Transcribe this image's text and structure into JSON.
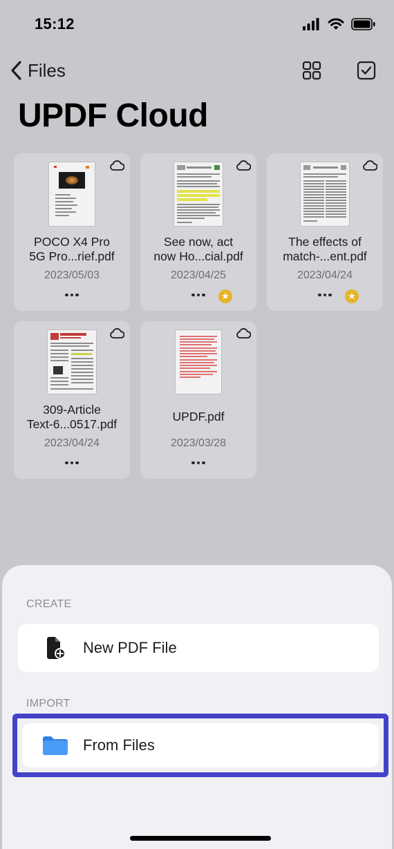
{
  "status": {
    "time": "15:12",
    "icons": [
      "signal-icon",
      "wifi-icon",
      "battery-icon"
    ]
  },
  "nav": {
    "back_label": "Files",
    "back_icon": "chevron-left-icon",
    "grid_icon": "grid-icon",
    "select_icon": "checkbox-icon"
  },
  "title": "UPDF Cloud",
  "files": [
    {
      "name": "POCO X4 Pro\n5G Pro...rief.pdf",
      "date": "2023/05/03",
      "starred": false,
      "thumb": "poco"
    },
    {
      "name": "See now, act\nnow Ho...cial.pdf",
      "date": "2023/04/25",
      "starred": true,
      "thumb": "paper-highlight"
    },
    {
      "name": "The effects of\nmatch-...ent.pdf",
      "date": "2023/04/24",
      "starred": true,
      "thumb": "paper"
    },
    {
      "name": "309-Article\nText-6...0517.pdf",
      "date": "2023/04/24",
      "starred": false,
      "thumb": "article"
    },
    {
      "name": "UPDF.pdf",
      "date": "2023/03/28",
      "starred": false,
      "thumb": "red-text"
    }
  ],
  "sheet": {
    "create_label": "CREATE",
    "new_pdf_label": "New PDF File",
    "import_label": "IMPORT",
    "from_files_label": "From Files"
  },
  "colors": {
    "highlight_frame": "#4343c9",
    "folder": "#3d8ef0",
    "star": "#e6b429"
  }
}
